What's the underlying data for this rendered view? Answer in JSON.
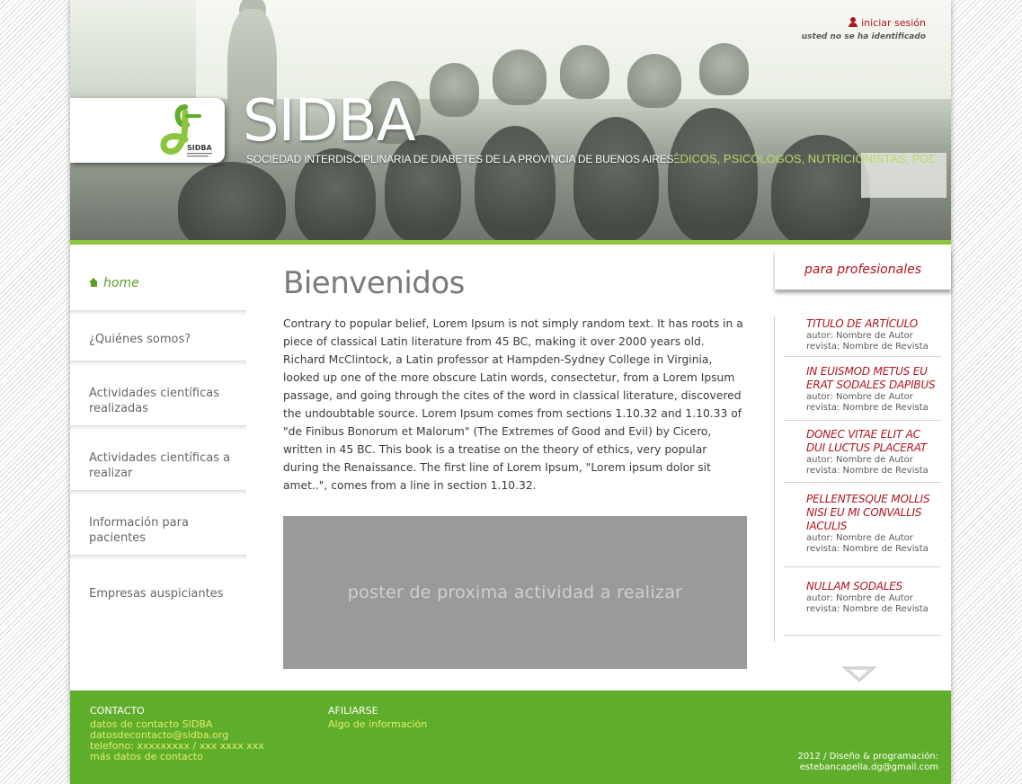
{
  "header": {
    "login_label": "iniciar sesión",
    "login_status": "usted no se ha identificado",
    "brand_title": "SIDBA",
    "brand_subtitle": "SOCIEDAD INTERDISCIPLINARIA DE DIABETES DE LA PROVINCIA DE BUENOS AIRES",
    "ticker": "MÉDICOS, PSICÓLOGOS, NUTRICIONISTAS, PODÓLOGOS",
    "logo_text": "SIDBA"
  },
  "nav": {
    "items": [
      {
        "label": "home"
      },
      {
        "label": "¿Quiénes somos?"
      },
      {
        "label": "Actividades científicas realizadas"
      },
      {
        "label": "Actividades científicas a realizar"
      },
      {
        "label": "Información para pacientes"
      },
      {
        "label": "Empresas auspiciantes"
      }
    ]
  },
  "main": {
    "title": "Bienvenidos",
    "body": "Contrary to popular belief, Lorem Ipsum is not simply random text. It has roots in a piece of classical Latin literature from 45 BC, making it over 2000 years old. Richard McClintock, a Latin professor at Hampden-Sydney College in Virginia, looked up one of the more obscure Latin words, consectetur, from a Lorem Ipsum passage, and going through the cites of the word in classical literature, discovered the undoubtable source. Lorem Ipsum comes from sections 1.10.32 and 1.10.33 of \"de Finibus Bonorum et Malorum\" (The Extremes of Good and Evil) by Cicero, written in 45 BC. This book is a treatise on the theory of ethics, very popular during the Renaissance. The first line of Lorem Ipsum, \"Lorem ipsum dolor sit amet..\", comes from a line in section 1.10.32.",
    "poster_text": "poster de proxima actividad a realizar"
  },
  "sidebar": {
    "tab_label": "para profesionales",
    "articles": [
      {
        "title": "TITULO DE ARTÍCULO",
        "author": "autor: Nombre de Autor",
        "journal": "revista: Nombre de Revista"
      },
      {
        "title": "IN EUISMOD METUS EU ERAT SODALES DAPIBUS",
        "author": "autor: Nombre de Autor",
        "journal": "revista: Nombre de Revista"
      },
      {
        "title": "DONEC VITAE ELIT AC DUI LUCTUS PLACERAT",
        "author": "autor: Nombre de Autor",
        "journal": "revista: Nombre de Revista"
      },
      {
        "title": "PELLENTESQUE MOLLIS NISI EU MI CONVALLIS IACULIS",
        "author": "autor: Nombre de Autor",
        "journal": "revista: Nombre de Revista"
      },
      {
        "title": "NULLAM SODALES",
        "author": "autor: Nombre de Autor",
        "journal": "revista: Nombre de Revista"
      }
    ]
  },
  "footer": {
    "contact_heading": "CONTACTO",
    "contact_lines": [
      "datos de contacto SIDBA",
      "datosdecontacto@sidba.org",
      "telefono: xxxxxxxxx / xxx xxxx xxx",
      "más datos de contacto"
    ],
    "join_heading": "AFILIARSE",
    "join_line": "Algo de información",
    "credit_line1": "2012 / Diseño & programación:",
    "credit_line2": "estebancapella.dg@gmail.com"
  },
  "colors": {
    "brand_green": "#8cc63f",
    "footer_green": "#5fae2b",
    "accent_red": "#b0141d",
    "footer_link": "#e3ec6a"
  }
}
